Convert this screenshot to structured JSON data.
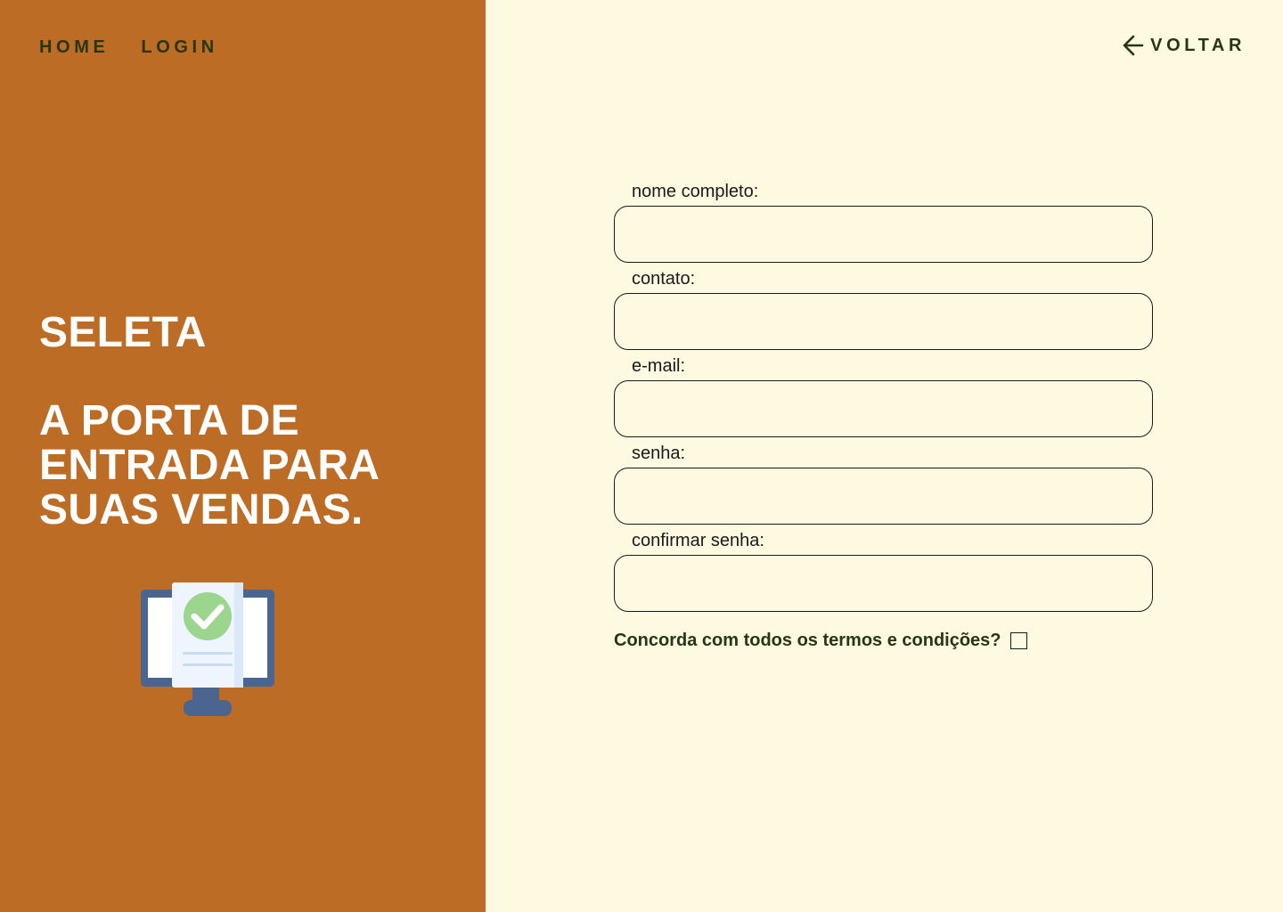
{
  "nav": {
    "home_label": "HOME",
    "login_label": "LOGIN"
  },
  "hero": {
    "brand": "SELETA",
    "tagline": "A PORTA DE ENTRADA PARA SUAS VENDAS."
  },
  "back": {
    "label": "VOLTAR",
    "icon": "arrow-left-icon"
  },
  "form": {
    "fields": [
      {
        "label": "nome completo:",
        "value": ""
      },
      {
        "label": "contato:",
        "value": ""
      },
      {
        "label": "e-mail:",
        "value": ""
      },
      {
        "label": "senha:",
        "value": ""
      },
      {
        "label": "confirmar senha:",
        "value": ""
      }
    ],
    "terms_label": "Concorda com todos os termos e condições?",
    "terms_checked": false
  },
  "colors": {
    "left_panel": "#BC6C25",
    "background": "#FEF9E1",
    "nav_text": "#283618"
  }
}
